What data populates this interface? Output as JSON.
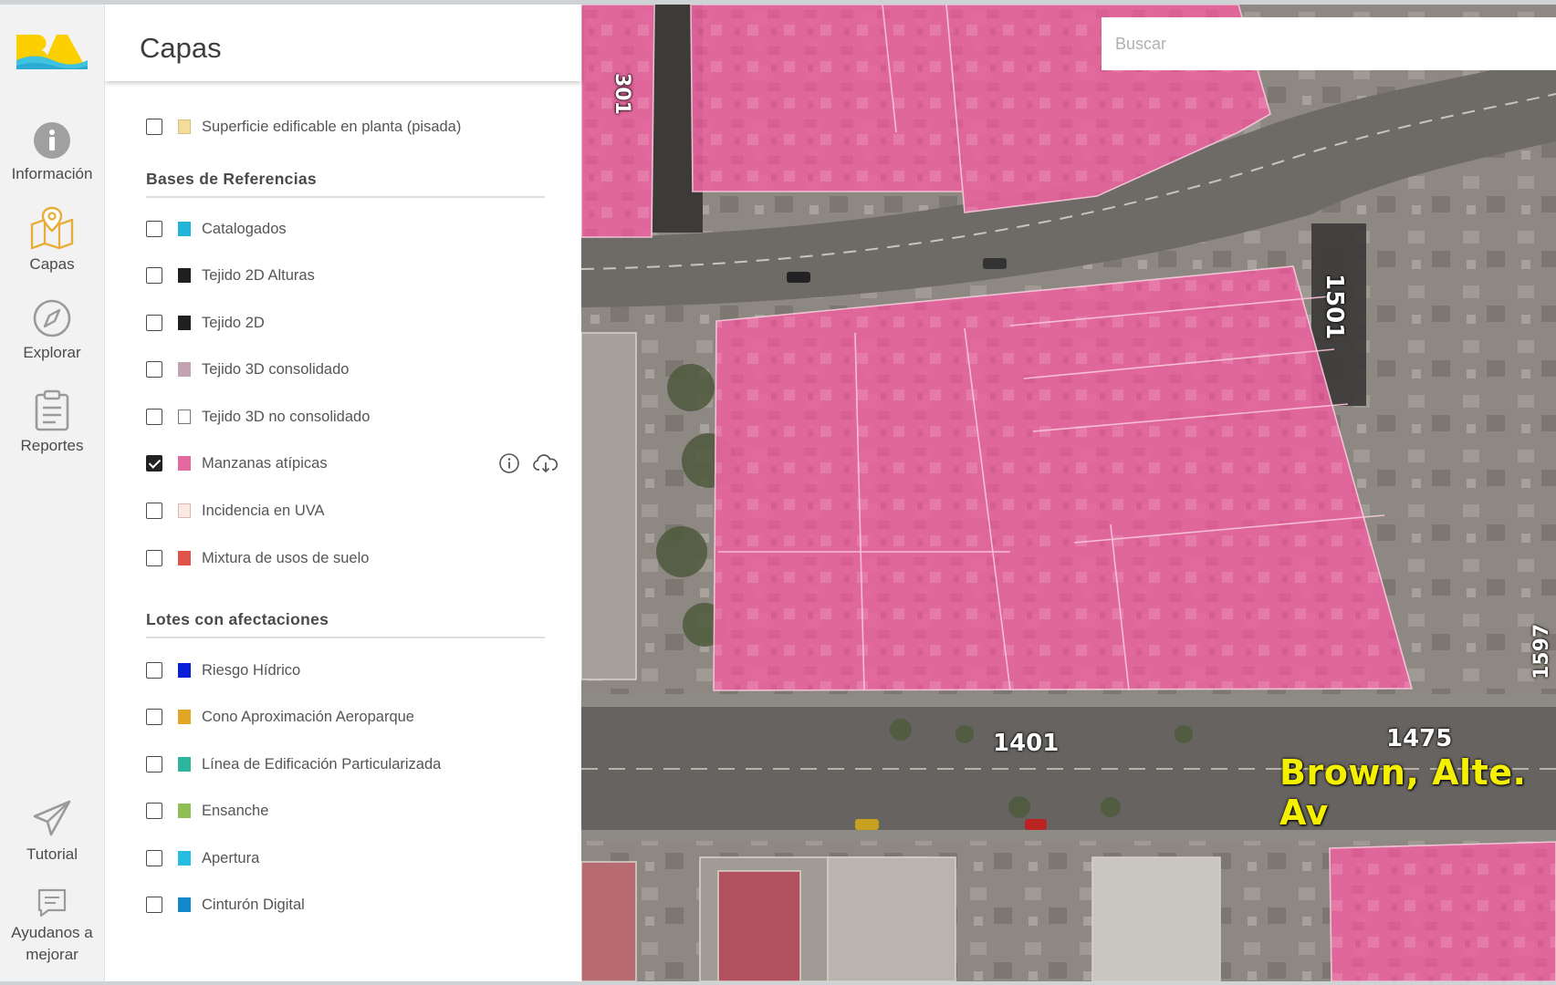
{
  "sidebar": {
    "logo_text": "BA",
    "items": [
      {
        "label": "Información",
        "icon": "info-icon"
      },
      {
        "label": "Capas",
        "icon": "map-layers-icon"
      },
      {
        "label": "Explorar",
        "icon": "compass-icon"
      },
      {
        "label": "Reportes",
        "icon": "clipboard-icon"
      },
      {
        "label": "Tutorial",
        "icon": "paper-plane-icon"
      },
      {
        "label": "Ayudanos a",
        "label2": "mejorar",
        "icon": "feedback-icon"
      }
    ]
  },
  "panel": {
    "title": "Capas",
    "top_layer": {
      "label": "Superficie edificable en planta (pisada)",
      "color": "#f5dc9a",
      "checked": false
    },
    "sections": [
      {
        "title": "Bases de Referencias",
        "layers": [
          {
            "label": "Catalogados",
            "color": "#21b5d8",
            "checked": false
          },
          {
            "label": "Tejido 2D Alturas",
            "color": "#1f1f1f",
            "checked": false
          },
          {
            "label": "Tejido 2D",
            "color": "#1f1f1f",
            "checked": false
          },
          {
            "label": "Tejido 3D consolidado",
            "color": "#c2a3b2",
            "checked": false
          },
          {
            "label": "Tejido 3D no consolidado",
            "color": "#ffffff",
            "checked": false
          },
          {
            "label": "Manzanas atípicas",
            "color": "#e5679f",
            "checked": true
          },
          {
            "label": "Incidencia en UVA",
            "color": "#fbeae3",
            "checked": false
          },
          {
            "label": "Mixtura de usos de suelo",
            "color": "#e0524a",
            "checked": false
          }
        ]
      },
      {
        "title": "Lotes con afectaciones",
        "layers": [
          {
            "label": "Riesgo Hídrico",
            "color": "#0a1ed8",
            "checked": false
          },
          {
            "label": "Cono Aproximación Aeroparque",
            "color": "#e2a524",
            "checked": false
          },
          {
            "label": "Línea de Edificación Particularizada",
            "color": "#2bb59c",
            "checked": false
          },
          {
            "label": "Ensanche",
            "color": "#8fbe52",
            "checked": false
          },
          {
            "label": "Apertura",
            "color": "#25bde0",
            "checked": false
          },
          {
            "label": "Cinturón Digital",
            "color": "#1187cc",
            "checked": false
          }
        ]
      }
    ]
  },
  "search": {
    "placeholder": "Buscar"
  },
  "map": {
    "highlight_color": "#e8659e",
    "labels": {
      "n1401": "1401",
      "n1475": "1475",
      "n1501": "1501",
      "n1597": "1597",
      "n301": "301",
      "street": "Brown, Alte. Av"
    }
  }
}
